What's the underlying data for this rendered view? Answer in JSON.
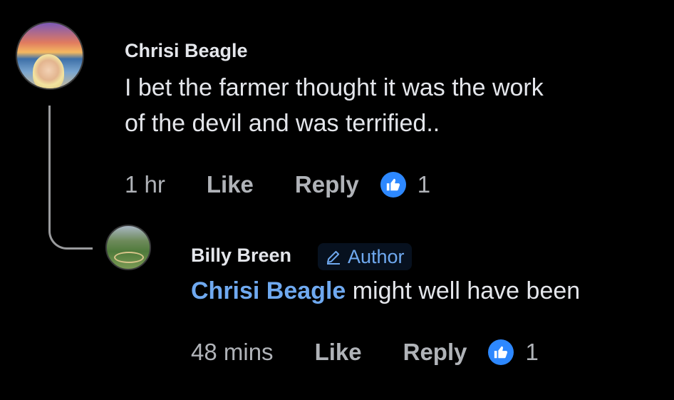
{
  "comment": {
    "author": "Chrisi Beagle",
    "text_line1": "I bet the farmer thought it was the work",
    "text_line2": "of the devil and was terrified..",
    "time": "1 hr",
    "like_label": "Like",
    "reply_label": "Reply",
    "reaction_count": "1"
  },
  "reply": {
    "author": "Billy Breen",
    "badge": "Author",
    "mention": "Chrisi Beagle",
    "text": " might well have been",
    "time": "48 mins",
    "like_label": "Like",
    "reply_label": "Reply",
    "reaction_count": "1"
  },
  "colors": {
    "background": "#000000",
    "text": "#e4e6eb",
    "secondary": "#b0b3b8",
    "mention": "#6fa9f0",
    "like_badge": "#2d88ff"
  },
  "icons": {
    "reaction": "thumbs-up-icon",
    "author_badge": "pencil-icon"
  }
}
